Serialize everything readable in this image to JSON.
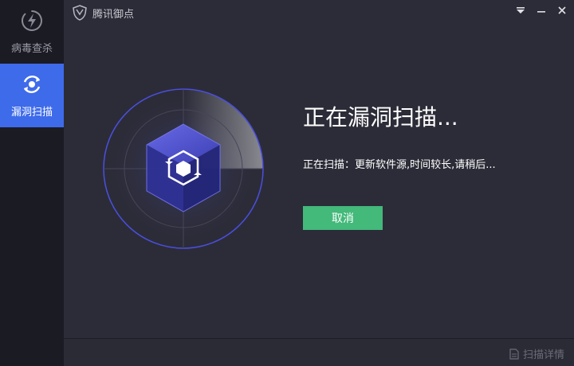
{
  "sidebar": {
    "items": [
      {
        "label": "病毒查杀",
        "icon": "lightning-bolt-icon",
        "active": false
      },
      {
        "label": "漏洞扫描",
        "icon": "refresh-scan-icon",
        "active": true
      }
    ]
  },
  "titlebar": {
    "app_name": "腾讯御点",
    "logo_icon": "shield-logo-icon",
    "buttons": [
      "dropdown-menu-icon",
      "minimize-icon",
      "close-icon"
    ]
  },
  "scan": {
    "title": "正在漏洞扫描...",
    "status": "正在扫描：更新软件源,时间较长,请稍后...",
    "cancel_label": "取消"
  },
  "footer": {
    "detail_label": "扫描详情",
    "detail_icon": "document-icon"
  },
  "colors": {
    "sidebar_bg": "#1b1b24",
    "active_blue": "#3e6bea",
    "main_bg": "#2c2c38",
    "cancel_green": "#43b97a",
    "radar_ring": "#4a4fe0"
  }
}
